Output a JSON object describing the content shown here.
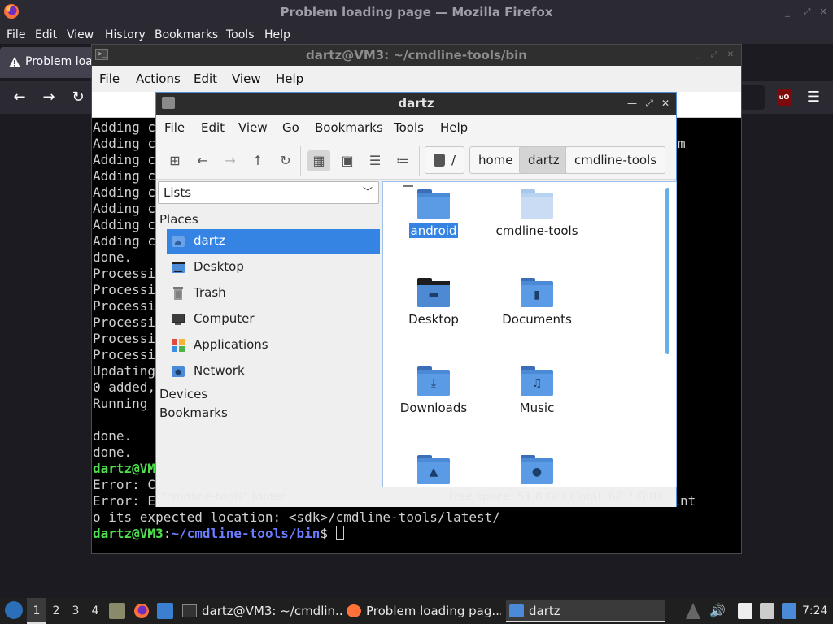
{
  "firefox": {
    "window_title": "Problem loading page — Mozilla Firefox",
    "menu": [
      "File",
      "Edit",
      "View",
      "History",
      "Bookmarks",
      "Tools",
      "Help"
    ],
    "tab_label": "Problem loading page"
  },
  "terminal": {
    "title": "dartz@VM3: ~/cmdline-tools/bin",
    "menu": [
      "File",
      "Actions",
      "Edit",
      "View",
      "Help"
    ],
    "lines": [
      "Adding c",
      "Adding c",
      "Adding c",
      "Adding c",
      "Adding c",
      "Adding c",
      "Adding c",
      "Adding c",
      "done.",
      "Processi",
      "Processi",
      "Processi",
      "Processi",
      "Processi",
      "Processi",
      "Updating",
      "0 added,",
      "Running ",
      "",
      "done.",
      "done."
    ],
    "right_fragment": "m",
    "prompt_fragment_1": "dartz@VM",
    "error_line_1": "Error: C",
    "error_line_2_start": "Error: E",
    "error_line_2_end": "e int",
    "error_line_3": "o its expected location: <sdk>/cmdline-tools/latest/",
    "prompt_user": "dartz@VM3",
    "prompt_path": "~/cmdline-tools/bin",
    "prompt_symbol": "$"
  },
  "filemanager": {
    "title": "dartz",
    "menu": [
      "File",
      "Edit",
      "View",
      "Go",
      "Bookmarks",
      "Tools",
      "Help"
    ],
    "breadcrumb": [
      "/",
      "home",
      "dartz",
      "cmdline-tools"
    ],
    "breadcrumb_active": "dartz",
    "sidepane_mode": "Lists",
    "sections": {
      "places": "Places",
      "devices": "Devices",
      "bookmarks": "Bookmarks"
    },
    "places": [
      {
        "label": "dartz",
        "icon": "home-folder-icon",
        "selected": true
      },
      {
        "label": "Desktop",
        "icon": "desktop-icon",
        "selected": false
      },
      {
        "label": "Trash",
        "icon": "trash-icon",
        "selected": false
      },
      {
        "label": "Computer",
        "icon": "computer-icon",
        "selected": false
      },
      {
        "label": "Applications",
        "icon": "applications-icon",
        "selected": false
      },
      {
        "label": "Network",
        "icon": "network-icon",
        "selected": false
      }
    ],
    "items": [
      {
        "label": "android",
        "icon": "folder-icon",
        "selected": true
      },
      {
        "label": "cmdline-tools",
        "icon": "folder-icon",
        "selected": false
      },
      {
        "label": "Desktop",
        "icon": "desktop-folder-icon",
        "selected": false
      },
      {
        "label": "Documents",
        "icon": "documents-folder-icon",
        "selected": false
      },
      {
        "label": "Downloads",
        "icon": "downloads-folder-icon",
        "selected": false
      },
      {
        "label": "Music",
        "icon": "music-folder-icon",
        "selected": false
      },
      {
        "label": "",
        "icon": "pictures-folder-icon",
        "selected": false
      },
      {
        "label": "",
        "icon": "public-folder-icon",
        "selected": false
      }
    ],
    "status_left": "\"cmdline-tools\" folder",
    "status_right": "Free space: 51.8 GiB (Total: 62.7 GiB)"
  },
  "taskbar": {
    "workspaces": [
      "1",
      "2",
      "3",
      "4"
    ],
    "active_workspace": "1",
    "tasks": [
      {
        "label": "dartz@VM3: ~/cmdlin...",
        "icon": "terminal-icon"
      },
      {
        "label": "Problem loading pag...",
        "icon": "firefox-icon"
      },
      {
        "label": "dartz",
        "icon": "folder-icon"
      }
    ],
    "clock": "7:24"
  },
  "colors": {
    "accent": "#3584e4",
    "terminal_prompt_user": "#4ee04e",
    "terminal_prompt_path": "#6a7cff",
    "ublock": "#7d0a0a"
  }
}
